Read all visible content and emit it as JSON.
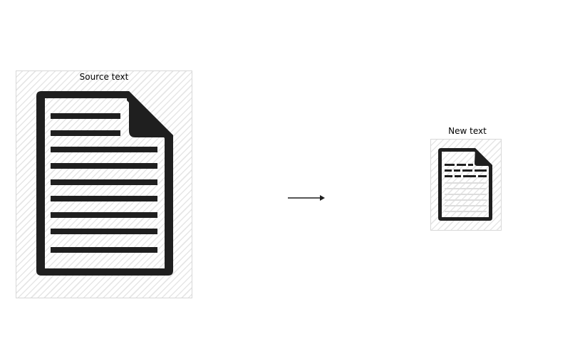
{
  "source": {
    "label": "Source text",
    "icon": "document-icon"
  },
  "target": {
    "label": "New text",
    "icon": "document-icon"
  },
  "transform": {
    "icon": "arrow-right-icon"
  },
  "colors": {
    "ink": "#1f1f1f",
    "hatch": "#e6e6e6",
    "panel_border": "#d8d8d8",
    "faded_line": "#dddddd"
  }
}
